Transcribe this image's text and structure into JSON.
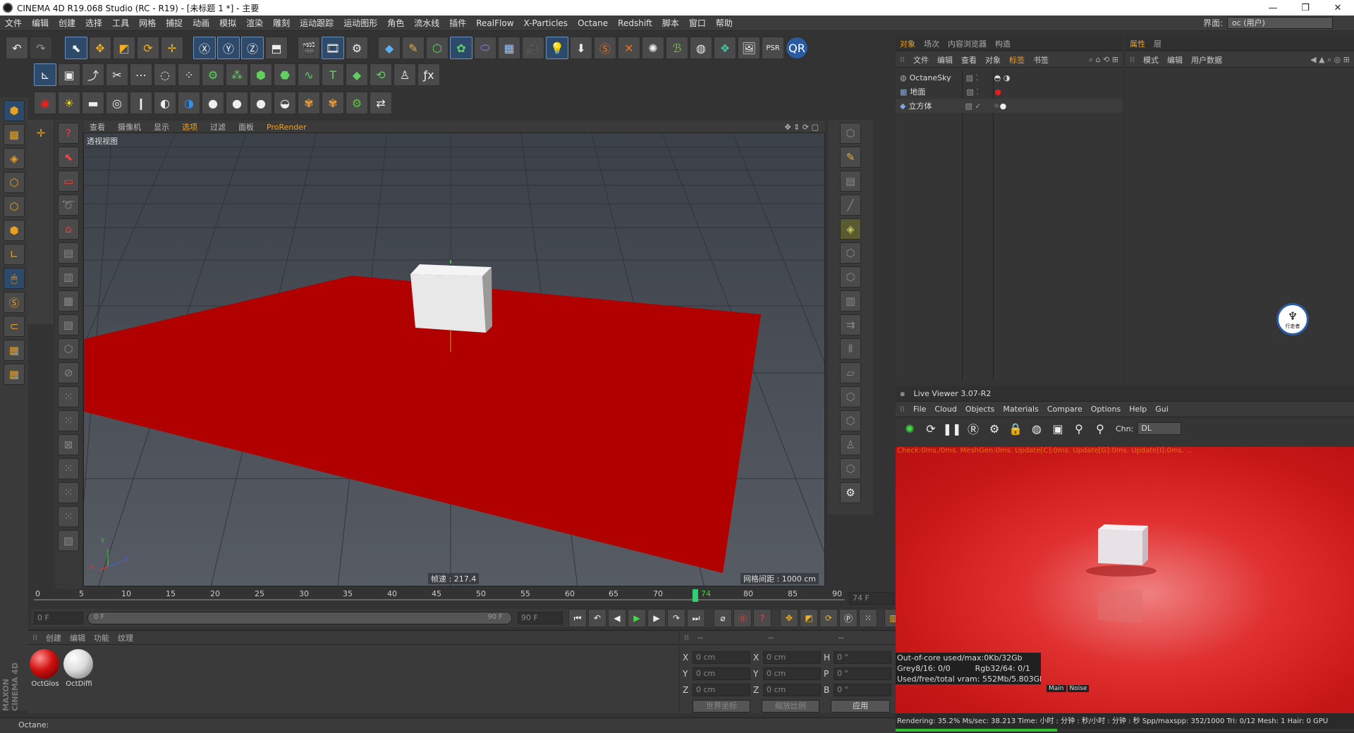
{
  "window": {
    "title": "CINEMA 4D R19.068 Studio (RC - R19) - [未标题 1 *] - 主要",
    "controls": [
      "—",
      "❐",
      "✕"
    ]
  },
  "menu": [
    "文件",
    "编辑",
    "创建",
    "选择",
    "工具",
    "网格",
    "捕捉",
    "动画",
    "模拟",
    "渲染",
    "雕刻",
    "运动跟踪",
    "运动图形",
    "角色",
    "流水线",
    "插件",
    "RealFlow",
    "X-Particles",
    "Octane",
    "Redshift",
    "脚本",
    "窗口",
    "帮助"
  ],
  "layout": {
    "label": "界面:",
    "value": "oc (用户)"
  },
  "viewport": {
    "menu": [
      "查看",
      "摄像机",
      "显示",
      "选项",
      "过滤",
      "面板",
      "ProRender"
    ],
    "active_menu": "选项",
    "view_name": "透视视图",
    "fps": "帧速 : 217.4",
    "grid_spacing": "网格间距 : 1000 cm",
    "axis": {
      "x": "X",
      "y": "Y",
      "z": "Z"
    }
  },
  "timeline": {
    "ticks": [
      "0",
      "5",
      "10",
      "15",
      "20",
      "25",
      "30",
      "35",
      "40",
      "45",
      "50",
      "55",
      "60",
      "65",
      "70",
      "74",
      "80",
      "85",
      "90"
    ],
    "current_frame": "74",
    "end_label": "74 F"
  },
  "time_controls": {
    "start": "0 F",
    "range_start": "0 F",
    "range_end": "90 F",
    "end": "90 F"
  },
  "material_panel": {
    "tabs": [
      "创建",
      "编辑",
      "功能",
      "纹理"
    ],
    "materials": [
      {
        "name": "OctGlos",
        "color": "#d01010"
      },
      {
        "name": "OctDiffi",
        "color": "#e8e8e8"
      }
    ]
  },
  "coord_panel": {
    "headers": [
      "--",
      "--",
      "--"
    ],
    "rows": [
      {
        "a": "X",
        "av": "0 cm",
        "b": "X",
        "bv": "0 cm",
        "c": "H",
        "cv": "0 °"
      },
      {
        "a": "Y",
        "av": "0 cm",
        "b": "Y",
        "bv": "0 cm",
        "c": "P",
        "cv": "0 °"
      },
      {
        "a": "Z",
        "av": "0 cm",
        "b": "Z",
        "bv": "0 cm",
        "c": "B",
        "cv": "0 °"
      }
    ],
    "mode1": "世界坐标",
    "mode2": "缩放比例",
    "apply": "应用"
  },
  "status": "Octane:",
  "object_panel": {
    "tabs": [
      "对象",
      "场次",
      "内容浏览器",
      "构造"
    ],
    "menu": [
      "文件",
      "编辑",
      "查看",
      "对象",
      "标签",
      "书签"
    ],
    "objects": [
      {
        "name": "OctaneSky"
      },
      {
        "name": "地面"
      },
      {
        "name": "立方体"
      }
    ]
  },
  "attr_panel": {
    "tabs": [
      "属性",
      "层"
    ],
    "menu": [
      "模式",
      "编辑",
      "用户数据"
    ],
    "watermark": "行走者"
  },
  "live_viewer": {
    "title": "Live Viewer 3.07-R2",
    "menu": [
      "File",
      "Cloud",
      "Objects",
      "Materials",
      "Compare",
      "Options",
      "Help",
      "Gui"
    ],
    "chn_label": "Chn:",
    "chn_value": "DL",
    "check_line": "Check:0ms./0ms. MeshGen:0ms. Update[C]:0ms. Update[G]:0ms. Update[I]:0ms. ...",
    "stats": [
      "Out-of-core used/max:0Kb/32Gb",
      "Grey8/16: 0/0          Rgb32/64: 0/1",
      "Used/free/total vram: 552Mb/5.803Gb/8Gb"
    ],
    "tabs": [
      "Main",
      "Noise"
    ],
    "render_line": "Rendering: 35.2%   Ms/sec: 38.213   Time: 小时 : 分钟 : 秒/小时 : 分钟 : 秒   Spp/maxspp: 352/1000   Tri: 0/12   Mesh: 1   Hair: 0   GPU",
    "progress": 0.352
  }
}
